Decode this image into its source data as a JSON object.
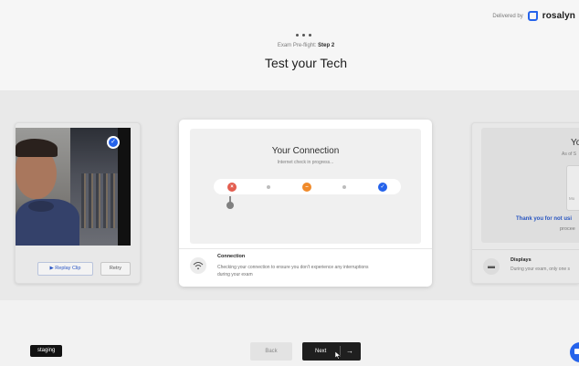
{
  "header": {
    "delivered_label": "Delivered by",
    "brand": "rosalyn",
    "step_prefix": "Exam Pre-flight:",
    "step_label": "Step 2",
    "title": "Test your Tech"
  },
  "left_card": {
    "replay_label": "▶ Replay Clip",
    "retry_label": "Retry"
  },
  "connection_card": {
    "title": "Your Connection",
    "subtitle": "Internet check in progress...",
    "nodes": [
      "error",
      "warning",
      "success"
    ],
    "detail_title": "Connection",
    "detail_text": "Checking your connection to ensure you don't experience any interruptions during your exam"
  },
  "right_card": {
    "title": "You",
    "subtitle": "As of S",
    "box_text": "Mo",
    "thanks": "Thank you for not usi",
    "proceed": "procee",
    "detail_title": "Displays",
    "detail_text": "During your exam, only one s"
  },
  "footer": {
    "env_badge": "staging",
    "back_label": "Back",
    "next_label": "Next",
    "next_arrow": "→"
  },
  "colors": {
    "accent": "#2563eb",
    "error": "#e35d4f",
    "warning": "#f08a2a",
    "dark": "#1f1f1f"
  }
}
